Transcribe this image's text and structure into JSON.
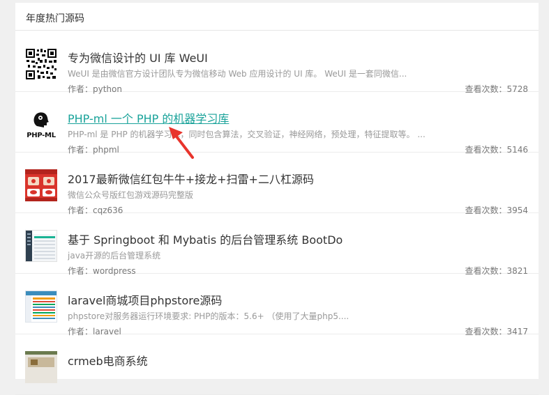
{
  "panel": {
    "title": "年度热门源码"
  },
  "items": [
    {
      "title": "专为微信设计的 UI 库 WeUI",
      "desc": "WeUI 是由微信官方设计团队专为微信移动 Web 应用设计的 UI 库。 WeUI 是一套同微信...",
      "author": "作者：python",
      "views": "查看次数：5728",
      "icon": "qr-code-icon"
    },
    {
      "title": "PHP-ml 一个 PHP 的机器学习库",
      "desc": "PHP-ml 是 PHP 的机器学习库，同时包含算法，交叉验证，神经网络，预处理，特征提取等。 ...",
      "author": "作者：phpml",
      "views": "查看次数：5146",
      "icon": "php-ml-logo",
      "logo_text": "PHP-ML"
    },
    {
      "title": "2017最新微信红包牛牛+接龙+扫雷+二八杠源码",
      "desc": "微信公众号版红包游戏源码完整版",
      "author": "作者：cqz636",
      "views": "查看次数：3954",
      "icon": "red-packet-thumbnail"
    },
    {
      "title": "基于 Springboot 和 Mybatis 的后台管理系统 BootDo",
      "desc": "java开源的后台管理系统",
      "author": "作者：wordpress",
      "views": "查看次数：3821",
      "icon": "admin-dashboard-thumbnail"
    },
    {
      "title": "laravel商城项目phpstore源码",
      "desc": "phpstore对服务器运行环境要求: PHP的版本：5.6+ （使用了大量php5....",
      "author": "作者：laravel",
      "views": "查看次数：3417",
      "icon": "store-thumbnail"
    },
    {
      "title": "crmeb电商系统",
      "icon": "shop-thumbnail"
    }
  ],
  "colors": {
    "link_active": "#1aa39a",
    "arrow": "#e8342c"
  }
}
